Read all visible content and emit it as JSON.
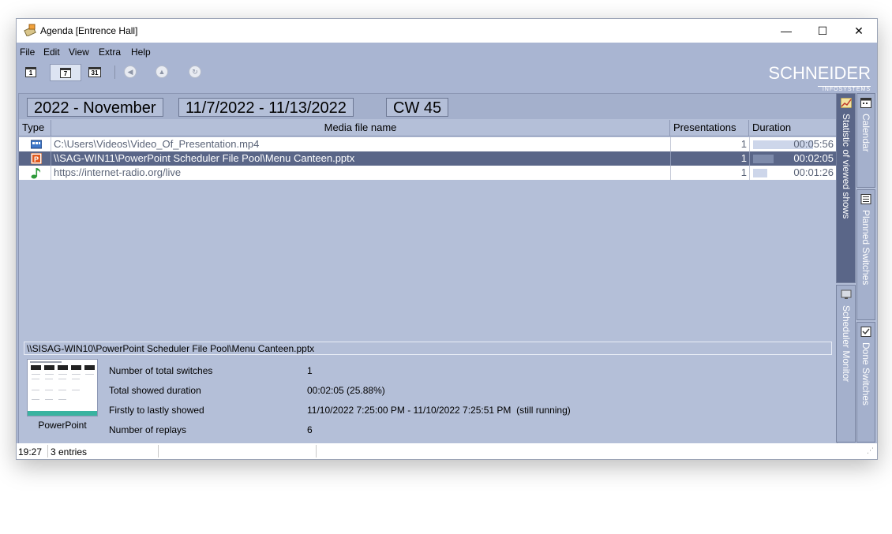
{
  "window": {
    "title": "Agenda [Entrence Hall]",
    "controls": {
      "minimize": "—",
      "maximize": "☐",
      "close": "✕"
    }
  },
  "menu": [
    "File",
    "Edit",
    "View",
    "Extra",
    "Help"
  ],
  "toolbar": {
    "buttons": [
      {
        "icon": "day-view-icon",
        "label": "1"
      },
      {
        "icon": "week-view-icon",
        "label": "7",
        "active": true
      },
      {
        "icon": "month-view-icon",
        "label": "31"
      },
      {
        "icon": "back-icon",
        "glyph": "◀"
      },
      {
        "icon": "up-icon",
        "glyph": "▲"
      },
      {
        "icon": "refresh-icon",
        "glyph": "↻"
      }
    ]
  },
  "logo": {
    "brand": "SCHNEIDER",
    "sub": "INFOSYSTEMS"
  },
  "period": {
    "month": "2022 - November",
    "range": "11/7/2022 - 11/13/2022",
    "week": "CW 45"
  },
  "table": {
    "headers": {
      "type": "Type",
      "name": "Media file name",
      "presentations": "Presentations",
      "duration": "Duration"
    },
    "rows": [
      {
        "type_icon": "video-file-icon",
        "name": "C:\\Users\\Videos\\Video_Of_Presentation.mp4",
        "presentations": "1",
        "duration": "00:05:56",
        "fraction": 0.76,
        "selected": false
      },
      {
        "type_icon": "powerpoint-file-icon",
        "name": "\\\\SAG-WIN11\\PowerPoint Scheduler File Pool\\Menu Canteen.pptx",
        "presentations": "1",
        "duration": "00:02:05",
        "fraction": 0.26,
        "selected": true
      },
      {
        "type_icon": "audio-stream-icon",
        "name": "https://internet-radio.org/live",
        "presentations": "1",
        "duration": "00:01:26",
        "fraction": 0.18,
        "selected": false
      }
    ]
  },
  "detail": {
    "path": "\\\\SISAG-WIN10\\PowerPoint Scheduler File Pool\\Menu Canteen.pptx",
    "thumbnail_label": "PowerPoint",
    "stats": [
      {
        "label": "Number of total switches",
        "value": "1"
      },
      {
        "label": "Total showed duration",
        "value": "00:02:05 (25.88%)"
      },
      {
        "label": "Firstly to lastly showed",
        "value": "11/10/2022 7:25:00 PM - 11/10/2022 7:25:51 PM  (still running)"
      },
      {
        "label": "Number of replays",
        "value": "6"
      }
    ]
  },
  "side_tabs": {
    "statistic": "Statistic of viewed shows",
    "scheduler": "Scheduler Monitor",
    "calendar": "Calendar",
    "planned": "Planned Switches",
    "done": "Done Switches"
  },
  "status": {
    "time": "19:27",
    "entries": "3 entries"
  },
  "colors": {
    "window_bg": "#a9b5d2",
    "selected_row": "#5a6688",
    "accent_ppt": "#e05a1e"
  }
}
